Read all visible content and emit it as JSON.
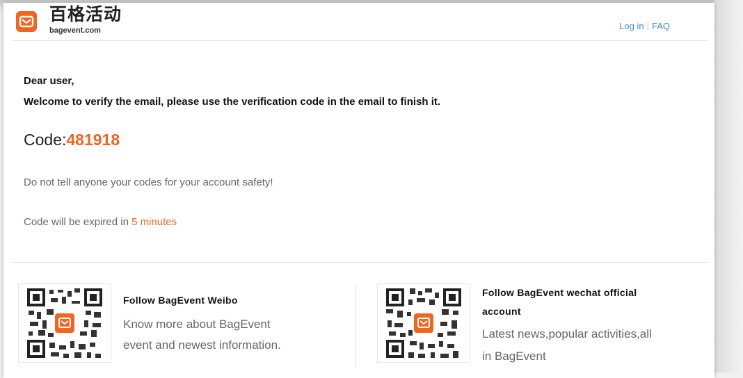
{
  "header": {
    "logo_cn": "百格活动",
    "logo_domain": "bagevent.com",
    "login_link": "Log in",
    "separator": "|",
    "faq_link": "FAQ"
  },
  "email": {
    "greeting": "Dear user,",
    "intro": "Welcome to verify the email, please use the verification code in the email to finish it.",
    "code_label": "Code:",
    "code_value": "481918",
    "safety_note": "Do not tell anyone your codes for your account safety!",
    "expiry_prefix": "Code will be expired in",
    "expiry_value": "5 minutes"
  },
  "follow": [
    {
      "title": "Follow BagEvent Weibo",
      "desc_line1": "Know more about BagEvent",
      "desc_line2": "event and newest information."
    },
    {
      "title_line1": "Follow BagEvent wechat official",
      "title_line2": "account",
      "desc_line1": "Latest news,popular activities,all",
      "desc_line2": "in BagEvent"
    }
  ],
  "colors": {
    "accent": "#f16522",
    "link": "#3a8fd0",
    "muted_text": "#666666"
  },
  "icons": {
    "logo": "bagevent-logo-icon",
    "qr": "qr-code-icon"
  }
}
